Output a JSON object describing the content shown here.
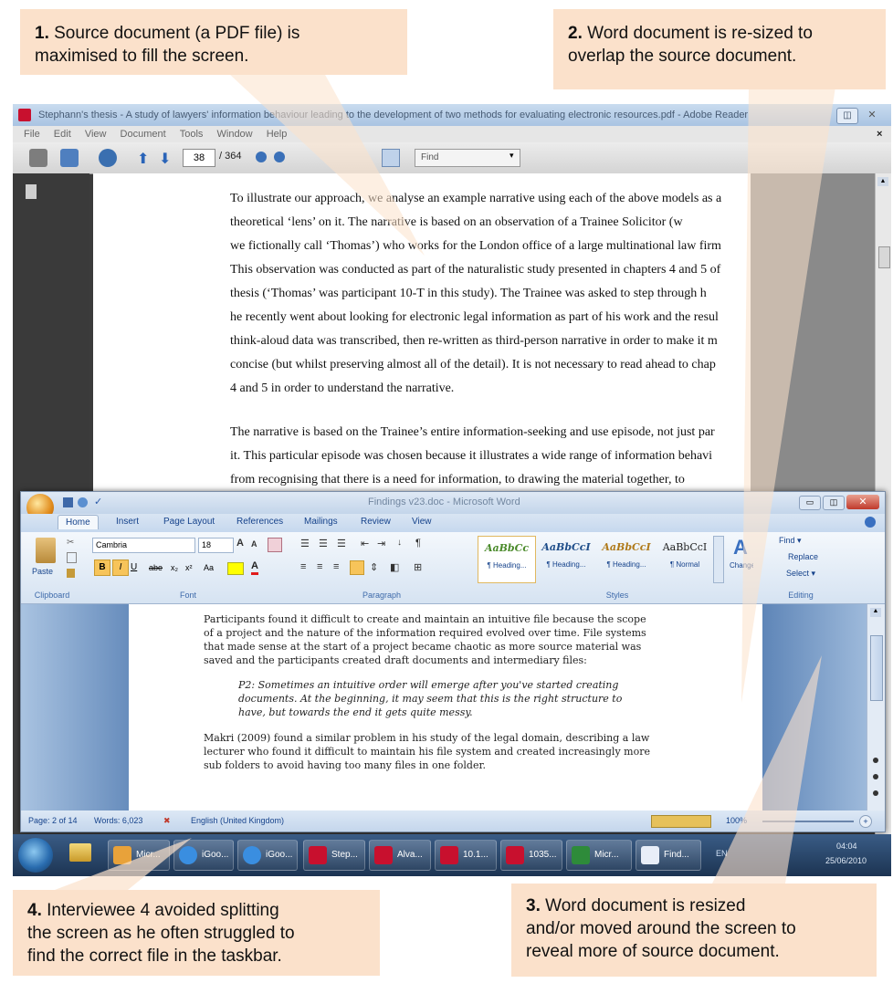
{
  "callouts": {
    "c1_num": "1.",
    "c1_text_a": " Source document (a PDF file) is",
    "c1_text_b": "maximised to fill the screen.",
    "c2_num": "2.",
    "c2_text_a": " Word document is re-sized to",
    "c2_text_b": "overlap the source document.",
    "c3_num": "3.",
    "c3_text_a": " Word document is resized",
    "c3_text_b": "and/or moved around the screen to",
    "c3_text_c": "reveal more of source document.",
    "c4_num": "4.",
    "c4_text_a": " Interviewee 4 avoided splitting",
    "c4_text_b": "the screen as he often struggled to",
    "c4_text_c": "find the correct file in the taskbar."
  },
  "reader": {
    "title": "Stephann's thesis - A study of lawyers' information behaviour leading to the development of two methods for evaluating electronic resources.pdf - Adobe Reader",
    "menu": [
      "File",
      "Edit",
      "View",
      "Document",
      "Tools",
      "Window",
      "Help"
    ],
    "page_current": "38",
    "page_total": "/ 364",
    "find_placeholder": "Find",
    "lines": [
      "To illustrate our approach, we analyse an example narrative using each of the above models as a",
      "theoretical ‘lens’ on it. The narrative is based on an observation of a Trainee Solicitor (w",
      "we fictionally call ‘Thomas’) who works for the London office of a large multinational law firm",
      "This observation was conducted as part of the naturalistic study presented in chapters 4 and 5 of",
      "thesis (‘Thomas’ was participant 10-T in this study). The Trainee was asked to step through h",
      "he recently went about looking for electronic legal information as part of his work and the resul",
      "think-aloud data was transcribed, then re-written as third-person narrative in order to make it m",
      "concise (but whilst preserving almost all of the detail). It is not necessary to read ahead to chap",
      "4 and 5 in order to understand the narrative.",
      "The narrative is based on the Trainee’s entire information-seeking and use episode, not just par",
      "it. This particular episode was chosen because it illustrates a wide range of information behavi",
      "from recognising that there is a need for information, to drawing the material together, to"
    ]
  },
  "word": {
    "title": "Findings v23.doc - Microsoft Word",
    "tabs": [
      "Home",
      "Insert",
      "Page Layout",
      "References",
      "Mailings",
      "Review",
      "View"
    ],
    "font_name": "Cambria",
    "font_size": "18",
    "paste_label": "Paste",
    "groups": [
      "Clipboard",
      "Font",
      "Paragraph",
      "Styles",
      "Editing"
    ],
    "styles": [
      {
        "sample": "AaBbCc",
        "name": "¶ Heading..."
      },
      {
        "sample": "AaBbCcI",
        "name": "¶ Heading..."
      },
      {
        "sample": "AaBbCcI",
        "name": "¶ Heading..."
      },
      {
        "sample": "AaBbCcI",
        "name": "¶ Normal"
      }
    ],
    "change_styles": "Change Styles",
    "editing": [
      "Find ▾",
      "Replace",
      "Select ▾"
    ],
    "para1": [
      "Participants found it difficult to create and maintain an intuitive file because the scope",
      "of a project and the nature of the information required evolved over time.  File systems",
      "that made sense at the start of a project became chaotic as more source material was",
      "saved and the participants created draft documents and intermediary files:"
    ],
    "quote": [
      "P2: Sometimes an intuitive order will emerge after you've started creating",
      "documents.  At the beginning, it may seem that this is the right structure to",
      "have, but towards the end it gets quite messy."
    ],
    "para2": [
      "Makri (2009) found a similar problem in his study of the legal domain, describing a law",
      "lecturer who found it difficult to maintain his file system and created increasingly more",
      "sub folders to avoid having too many files in one folder."
    ],
    "status_page": "Page: 2 of 14",
    "status_words": "Words: 6,023",
    "status_lang": "English (United Kingdom)",
    "zoom": "100%"
  },
  "taskbar": {
    "items": [
      "Micr...",
      "iGoo...",
      "iGoo...",
      "Step...",
      "Alva...",
      "10.1...",
      "1035...",
      "Micr...",
      "Find..."
    ],
    "lang": "EN",
    "time": "04:04",
    "date": "25/06/2010"
  },
  "colors": {
    "callout": "#fbe1cb",
    "word_blue": "#15428b",
    "pdf_red": "#c8102e"
  }
}
